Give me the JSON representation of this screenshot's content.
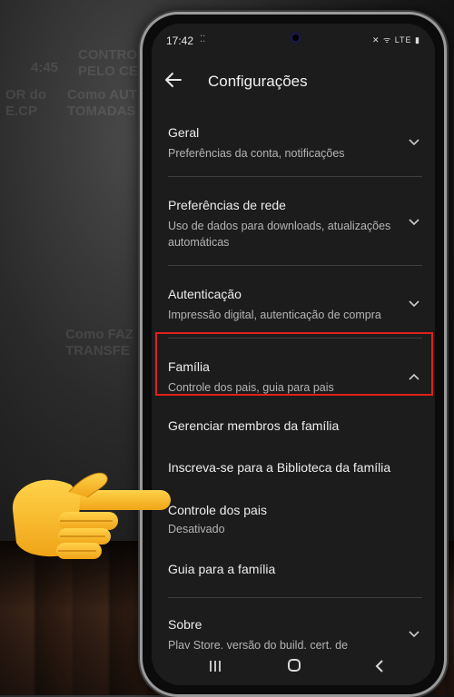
{
  "background": {
    "texts": [
      {
        "id": "bg1",
        "text": "CONTROL\nPELO CE"
      },
      {
        "id": "bg2",
        "text": "4:45"
      },
      {
        "id": "bg3",
        "text": "Como AUT\nTOMADAS"
      },
      {
        "id": "bg4",
        "text": "OR do\nE.CP"
      },
      {
        "id": "bg5",
        "text": "Como FAZ\nTRANSFE"
      }
    ]
  },
  "status_bar": {
    "time": "17:42",
    "notif": "⁚⁚",
    "right": "✕ ᯤ LTE ▮"
  },
  "app_bar": {
    "title": "Configurações"
  },
  "settings": [
    {
      "label": "Geral",
      "sub": "Preferências da conta, notificações"
    },
    {
      "label": "Preferências de rede",
      "sub": "Uso de dados para downloads, atualizações automáticas"
    },
    {
      "label": "Autenticação",
      "sub": "Impressão digital, autenticação de compra"
    },
    {
      "label": "Família",
      "sub": "Controle dos pais, guia para pais"
    },
    {
      "label": "Sobre",
      "sub": "Play Store, versão do build, cert. de"
    }
  ],
  "family_items": [
    {
      "label": "Gerenciar membros da família"
    },
    {
      "label": "Inscreva-se para a Biblioteca da família"
    },
    {
      "label": "Controle dos pais",
      "sub": "Desativado"
    },
    {
      "label": "Guia para a família"
    }
  ],
  "colors": {
    "highlight": "#e0201c",
    "screen_bg": "#1c1c1c"
  },
  "icons": {
    "pointer": "backhand-index-pointing-right"
  }
}
